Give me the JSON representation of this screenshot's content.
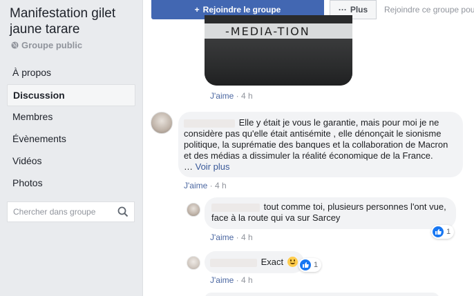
{
  "group": {
    "title": "Manifestation gilet jaune tarare",
    "type": "Groupe public"
  },
  "nav": {
    "items": [
      "À propos",
      "Discussion",
      "Membres",
      "Évènements",
      "Vidéos",
      "Photos"
    ],
    "active": "Discussion"
  },
  "search": {
    "placeholder": "Chercher dans groupe"
  },
  "topbar": {
    "join_label": "Rejoindre le groupe",
    "more_label": "Plus",
    "hint": "Rejoindre ce groupe pou"
  },
  "post_image": {
    "banner_text": "-MEDIA-TION"
  },
  "comments": [
    {
      "meta": {
        "like": "J'aime",
        "sep": "·",
        "time": "4 h"
      }
    },
    {
      "text_lines": [
        "Elle y était je vous le garantie, mais pour moi je ne",
        "considère pas qu'elle était antisémite , elle dénonçait le sionisme",
        "politique, la suprématie des banques et la collaboration de Macron",
        "et des médias a dissimuler la réalité économique de la France."
      ],
      "ellipsis": "…",
      "see_more": "Voir plus",
      "meta": {
        "like": "J'aime",
        "sep": "·",
        "time": "4 h"
      }
    },
    {
      "text_lines": [
        "tout comme toi, plusieurs personnes l'ont vue,",
        "face à la route qui va sur Sarcey"
      ],
      "reaction_count": "1",
      "meta": {
        "like": "J'aime",
        "sep": "·",
        "time": "4 h"
      }
    },
    {
      "text": "Exact",
      "reaction_count": "1",
      "meta": {
        "like": "J'aime",
        "sep": "·",
        "time": "4 h"
      }
    }
  ],
  "colors": {
    "brand": "#4267b2",
    "like_blue": "#1877f2",
    "sidebar_bg": "#e9ebee",
    "bubble_bg": "#f2f3f5"
  }
}
